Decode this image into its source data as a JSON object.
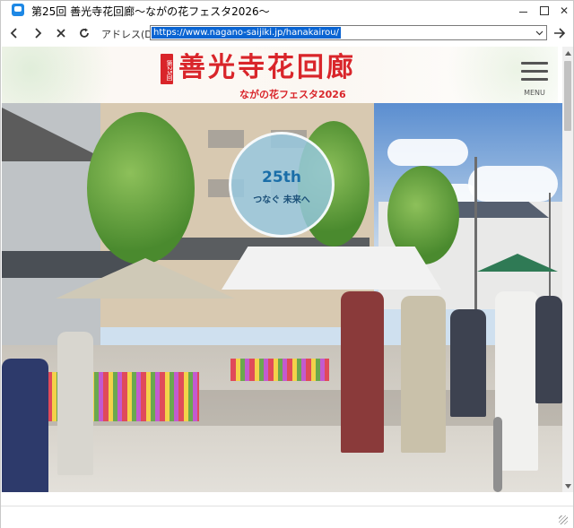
{
  "window": {
    "title": "第25回 善光寺花回廊〜ながの花フェスタ2026〜",
    "controls": {
      "minimize": "",
      "maximize": "",
      "close": "✕"
    }
  },
  "navbar": {
    "back_icon": "arrow-left-icon",
    "forward_icon": "arrow-right-icon",
    "stop_icon": "close-icon",
    "reload_icon": "reload-icon",
    "address_label": "アドレス(D)",
    "url": "https://www.nagano-saijiki.jp/hanakairou/",
    "go_icon": "arrow-right-icon"
  },
  "site_header": {
    "badge": "第25回",
    "title": "善光寺花回廊",
    "subtitle": "ながの花フェスタ2026",
    "menu_label": "MENU"
  },
  "hero": {
    "circle_main": "25th",
    "circle_sub": "つなぐ 未来へ"
  },
  "colors": {
    "brand_red": "#d9252a",
    "url_highlight": "#0a64d2",
    "circle_blue": "#1a6ea8"
  }
}
